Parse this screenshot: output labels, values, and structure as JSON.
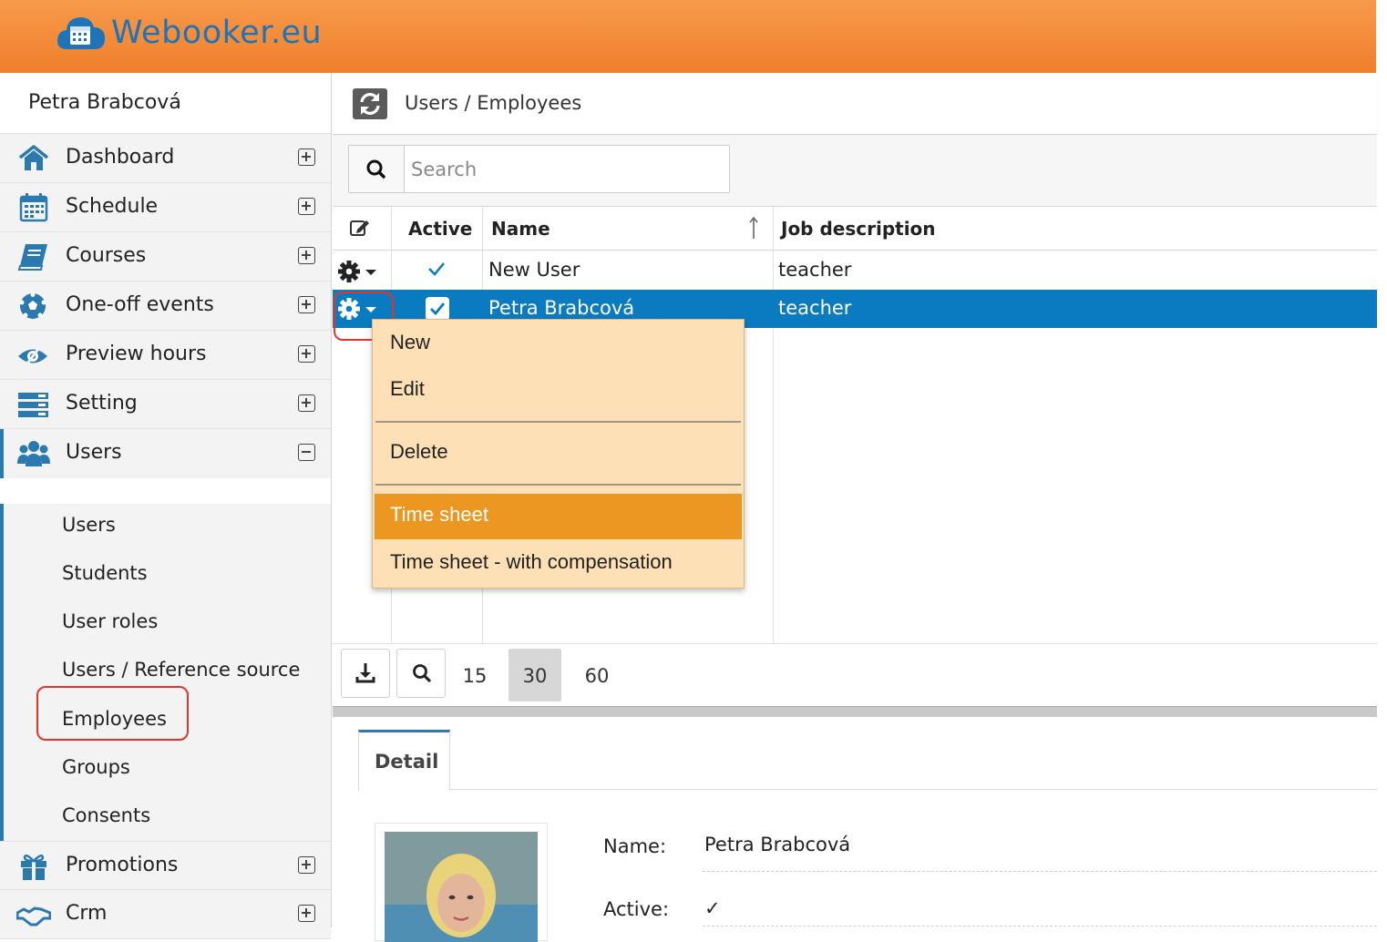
{
  "app": {
    "logo_text": "Webooker.eu"
  },
  "sidebar": {
    "user_name": "Petra Brabcová",
    "items": [
      {
        "label": "Dashboard",
        "icon": "home-icon",
        "toggle": "expand"
      },
      {
        "label": "Schedule",
        "icon": "calendar-icon",
        "toggle": "expand"
      },
      {
        "label": "Courses",
        "icon": "book-icon",
        "toggle": "expand"
      },
      {
        "label": "One-off events",
        "icon": "soccer-ball-icon",
        "toggle": "expand"
      },
      {
        "label": "Preview hours",
        "icon": "eye-icon",
        "toggle": "expand"
      },
      {
        "label": "Setting",
        "icon": "server-icon",
        "toggle": "expand"
      },
      {
        "label": "Users",
        "icon": "users-icon",
        "toggle": "collapse"
      },
      {
        "label": "Promotions",
        "icon": "gift-icon",
        "toggle": "expand"
      },
      {
        "label": "Crm",
        "icon": "handshake-icon",
        "toggle": "expand"
      }
    ],
    "users_subitems": [
      "Users",
      "Students",
      "User roles",
      "Users / Reference source",
      "Employees",
      "Groups",
      "Consents"
    ]
  },
  "header": {
    "breadcrumb": "Users / Employees"
  },
  "search": {
    "placeholder": "Search",
    "value": ""
  },
  "grid": {
    "columns": [
      "Active",
      "Name",
      "Job description"
    ],
    "rows": [
      {
        "active": true,
        "name": "New User",
        "job": "teacher",
        "selected": false
      },
      {
        "active": true,
        "name": "Petra Brabcová",
        "job": "teacher",
        "selected": true
      }
    ]
  },
  "context_menu": {
    "items": [
      "New",
      "Edit",
      "Delete",
      "Time sheet",
      "Time sheet - with compensation"
    ],
    "active_item": "Time sheet"
  },
  "pager": {
    "page_sizes": [
      "15",
      "30",
      "60"
    ],
    "current_size": "30"
  },
  "detail": {
    "tab": "Detail",
    "name_label": "Name:",
    "name_value": "Petra Brabcová",
    "active_label": "Active:",
    "active_value": "✓"
  },
  "colors": {
    "accent": "#ef7f2a",
    "brand_blue": "#1f73b8",
    "selection": "#0a7bc0",
    "menu_bg": "#fde0b5",
    "menu_active": "#ec9722",
    "annotation": "#e2352a"
  }
}
